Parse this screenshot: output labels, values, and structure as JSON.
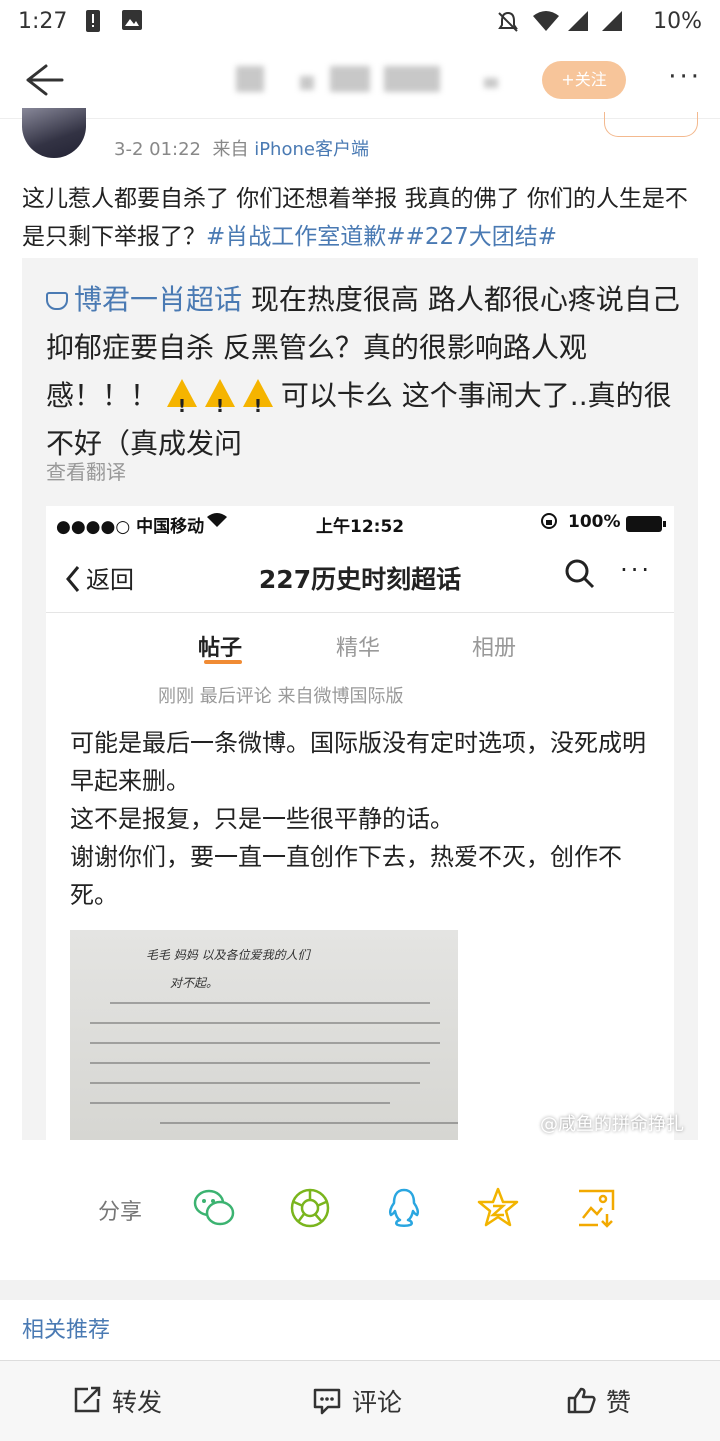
{
  "status_bar": {
    "time": "1:27",
    "battery": "10%"
  },
  "nav": {
    "follow_label": "+关注",
    "more": "···"
  },
  "author": {
    "date": "3-2 01:22",
    "from_label": "来自",
    "client": "iPhone客户端"
  },
  "post": {
    "text": "这儿惹人都要自杀了 你们还想着举报 我真的佛了 你们的人生是不是只剩下举报了？",
    "tags": "#肖战工作室道歉##227大团结#"
  },
  "repost": {
    "topic": "博君一肖超话",
    "text_a": " 现在热度很高 路人都很心疼说自己抑郁症要自杀 反黑管么？真的很影响路人观感！！！ ",
    "text_b": "可以卡么 这个事闹大了..真的很不好（真成发问",
    "translate": "查看翻译",
    "watermark": "@咸鱼的拼命挣扎"
  },
  "screenshot": {
    "carrier": "●●●●○ 中国移动",
    "time": "上午12:52",
    "battery": "100%",
    "back": "返回",
    "title": "227历史时刻超话",
    "more": "···",
    "tabs": [
      "帖子",
      "精华",
      "相册"
    ],
    "meta": "刚刚 最后评论 来自微博国际版",
    "body": "可能是最后一条微博。国际版没有定时选项，没死成明早起来删。\n这不是报复，只是一些很平静的话。\n谢谢你们，要一直一直创作下去，热爱不灭，创作不死。",
    "letter_lines": [
      "毛毛 妈妈 以及各位爱我的人们",
      "对不起。"
    ]
  },
  "share": {
    "label": "分享"
  },
  "related": {
    "label": "相关推荐"
  },
  "bottom": {
    "repost": "转发",
    "comment": "评论",
    "like": "赞"
  }
}
